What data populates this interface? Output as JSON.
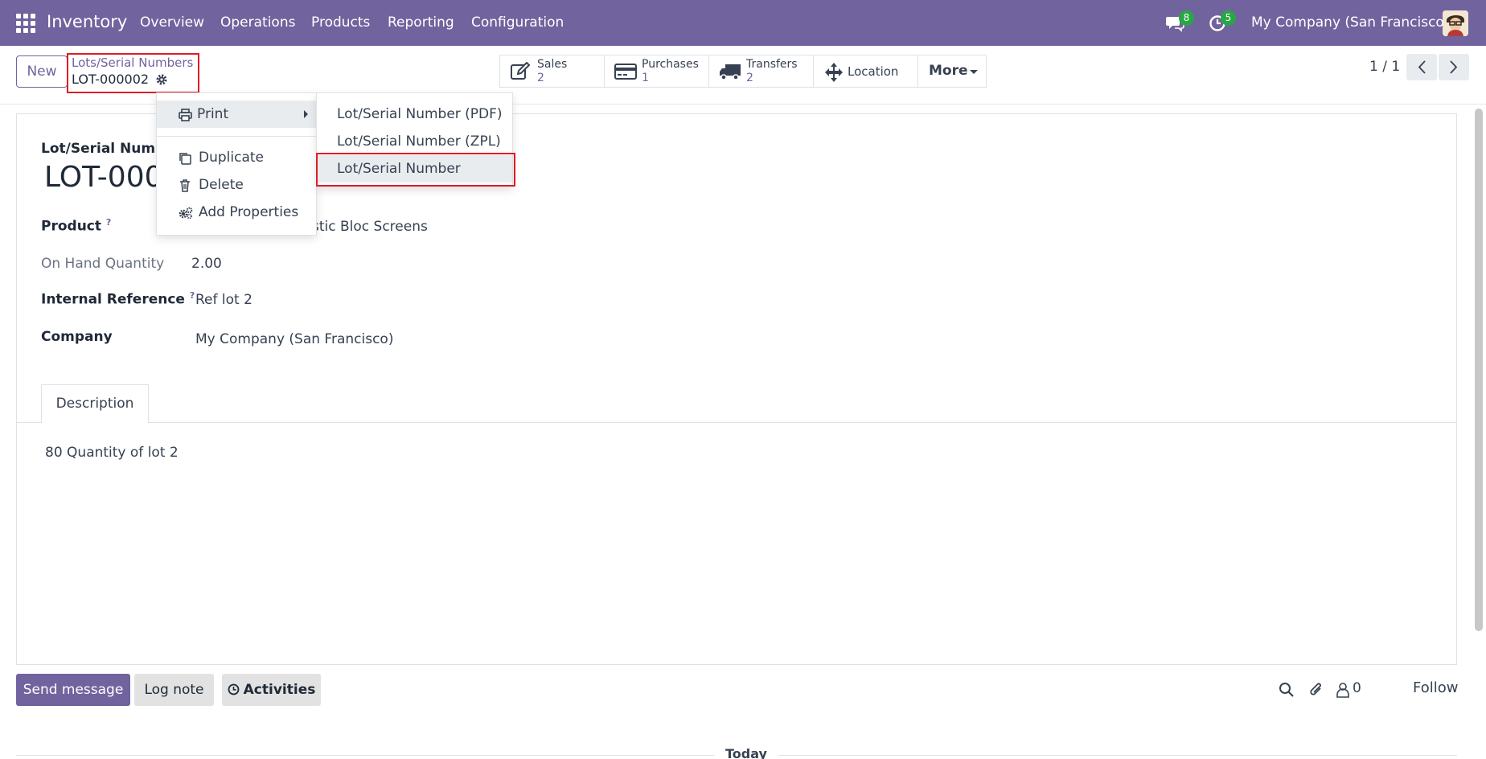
{
  "navbar": {
    "app_name": "Inventory",
    "menu": [
      "Overview",
      "Operations",
      "Products",
      "Reporting",
      "Configuration"
    ],
    "messages_count": "8",
    "activities_count": "5",
    "company": "My Company (San Francisco)",
    "accent": "#71639e"
  },
  "control_panel": {
    "new_label": "New",
    "breadcrumb_parent": "Lots/Serial Numbers",
    "breadcrumb_current": "LOT-000002",
    "smart_buttons": [
      {
        "label": "Sales",
        "value": "2",
        "icon": "edit-icon"
      },
      {
        "label": "Purchases",
        "value": "1",
        "icon": "credit-card-icon"
      },
      {
        "label": "Transfers",
        "value": "2",
        "icon": "truck-icon"
      },
      {
        "label": "Location",
        "icon": "arrows-move-icon"
      }
    ],
    "more_label": "More",
    "pager": "1 / 1"
  },
  "form": {
    "lot_label": "Lot/Serial Numbe",
    "lot_value": "LOT-0000",
    "product_label": "Product",
    "product_value": "stic Bloc Screens",
    "qty_label": "On Hand Quantity",
    "qty_value": "2.00",
    "ref_label": "Internal Reference",
    "ref_value": "Ref lot 2",
    "company_label": "Company",
    "company_value": "My Company (San Francisco)",
    "help_mark": "?",
    "tab_description": "Description",
    "description_text": "80 Quantity of lot 2"
  },
  "action_menu": {
    "print": "Print",
    "duplicate": "Duplicate",
    "delete": "Delete",
    "add_properties": "Add Properties"
  },
  "print_submenu": [
    "Lot/Serial Number (PDF)",
    "Lot/Serial Number (ZPL)",
    "Lot/Serial Number"
  ],
  "chatter": {
    "send_message": "Send message",
    "log_note": "Log note",
    "activities": "Activities",
    "followers_count": "0",
    "follow": "Follow",
    "today": "Today"
  }
}
